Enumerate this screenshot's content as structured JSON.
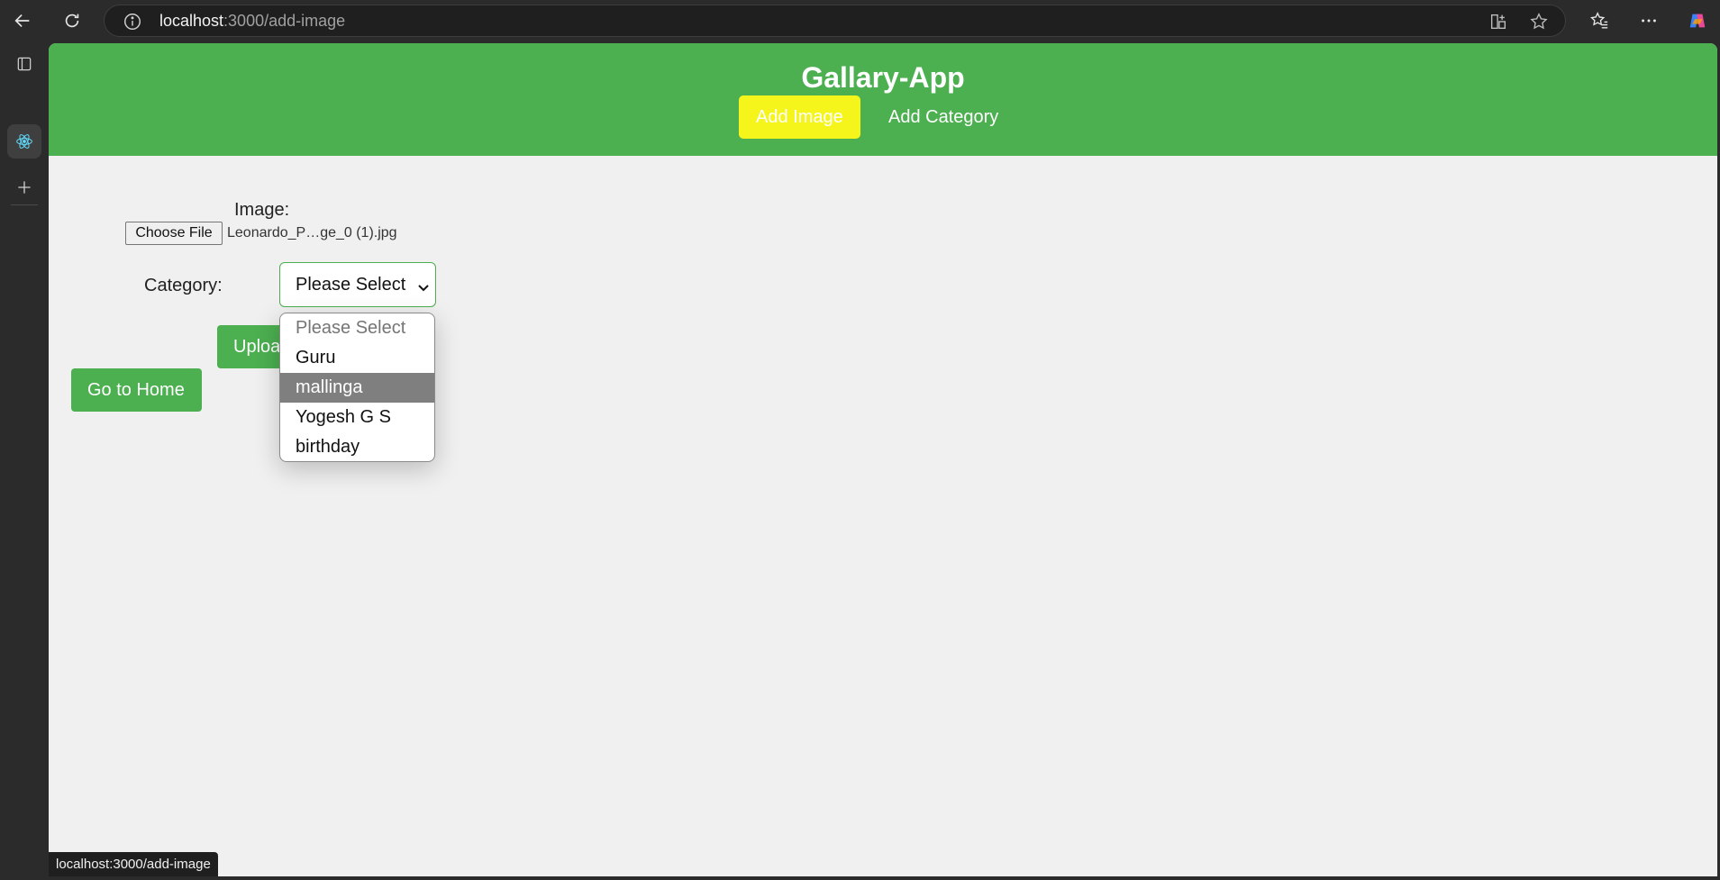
{
  "browser": {
    "url_host": "localhost",
    "url_path": ":3000/add-image",
    "status_url": "localhost:3000/add-image",
    "icons": {
      "back": "back-arrow-icon",
      "refresh": "refresh-icon",
      "info": "info-icon",
      "app_available": "app-available-icon",
      "favorite": "star-icon",
      "favorites": "favorites-icon",
      "more": "more-icon",
      "copilot": "copilot-icon"
    },
    "siderail_icons": [
      "tab-actions-icon",
      "tab-favicon-dot",
      "react-icon",
      "new-tab-plus-icon"
    ]
  },
  "app": {
    "title": "Gallary-App",
    "nav": [
      {
        "label": "Add Image",
        "active": true
      },
      {
        "label": "Add Category",
        "active": false
      }
    ],
    "colors": {
      "header": "#4caf50",
      "active_nav": "#f5f51c",
      "button": "#4caf50"
    }
  },
  "form": {
    "image_label": "Image:",
    "file_button": "Choose File",
    "file_name": "Leonardo_P…ge_0 (1).jpg",
    "category_label": "Category:",
    "category_selected": "Please Select",
    "category_options": [
      "Please Select",
      "Guru",
      "mallinga",
      "Yogesh G S",
      "birthday"
    ],
    "highlighted_option": "mallinga",
    "upload_button": "Upload",
    "home_button": "Go to Home"
  }
}
